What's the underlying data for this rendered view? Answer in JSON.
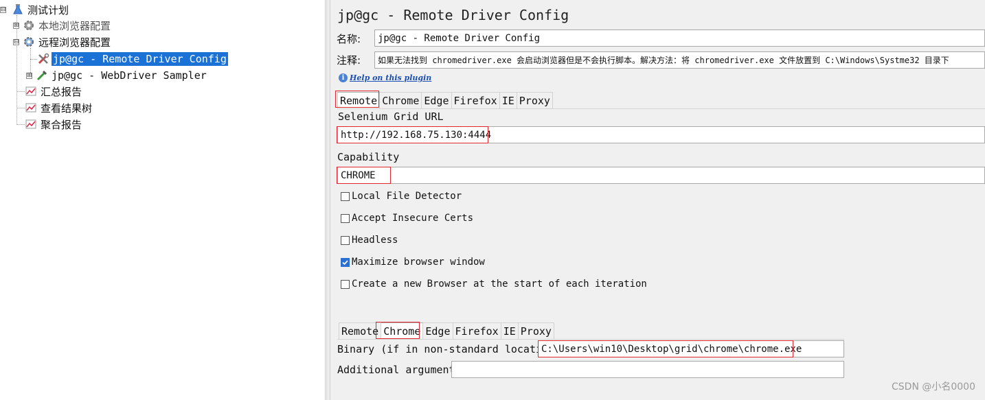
{
  "tree": {
    "root": {
      "label": "测试计划",
      "expander": "⊟"
    },
    "items": [
      {
        "label": "本地浏览器配置",
        "expander": "⊞"
      },
      {
        "label": "远程浏览器配置",
        "expander": "⊟"
      },
      {
        "label": "jp@gc - Remote Driver Config",
        "selected": true
      },
      {
        "label": "jp@gc - WebDriver Sampler",
        "expander": "⊞"
      },
      {
        "label": "汇总报告"
      },
      {
        "label": "查看结果树"
      },
      {
        "label": "聚合报告"
      }
    ]
  },
  "panel": {
    "title": "jp@gc - Remote Driver Config",
    "name_label": "名称:",
    "name_value": "jp@gc - Remote Driver Config",
    "comment_label": "注释:",
    "comment_value": "如果无法找到 chromedriver.exe 会启动浏览器但是不会执行脚本。解决方法：将 chromedriver.exe 文件放置到 C:\\Windows\\Systme32 目录下",
    "help_link": "Help on this plugin",
    "tabs_top": [
      "Remote",
      "Chrome",
      "Edge",
      "Firefox",
      "IE",
      "Proxy"
    ],
    "active_tab_top": "Remote",
    "grid_url_label": "Selenium Grid URL",
    "grid_url_value": "http://192.168.75.130:4444",
    "capability_label": "Capability",
    "capability_value": "CHROME",
    "checkboxes": [
      {
        "label": "Local File Detector",
        "checked": false
      },
      {
        "label": "Accept Insecure Certs",
        "checked": false
      },
      {
        "label": "Headless",
        "checked": false
      },
      {
        "label": "Maximize browser window",
        "checked": true
      },
      {
        "label": "Create a new Browser at the start of each iteration",
        "checked": false
      }
    ],
    "tabs_bottom": [
      "Remote",
      "Chrome",
      "Edge",
      "Firefox",
      "IE",
      "Proxy"
    ],
    "active_tab_bottom": "Chrome",
    "binary_label": "Binary (if in non-standard location)",
    "binary_value": "C:\\Users\\win10\\Desktop\\grid\\chrome\\chrome.exe",
    "additional_args_label": "Additional arguments",
    "additional_args_value": ""
  },
  "watermark": "CSDN @小名0000",
  "colors": {
    "selection": "#1a72d6",
    "highlight": "#e0262f",
    "checkbox_on": "#2b6fd0"
  }
}
